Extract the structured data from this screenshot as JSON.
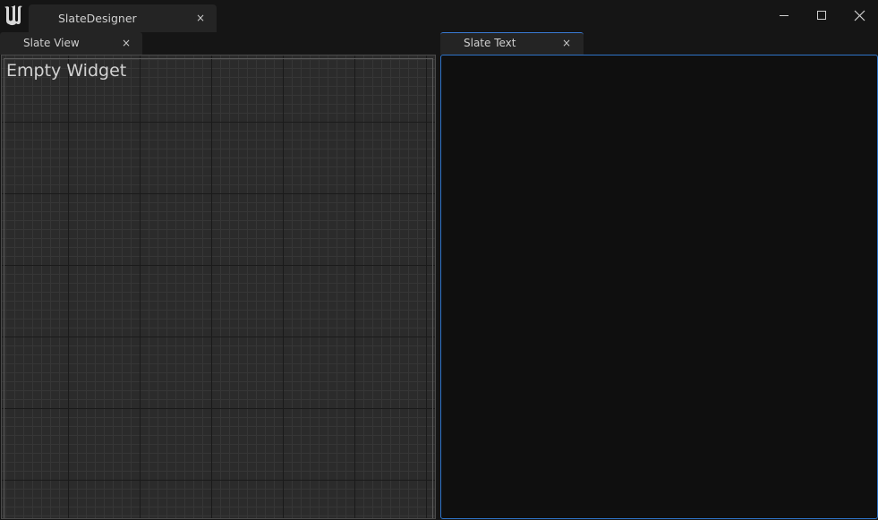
{
  "titlebar": {
    "logo_icon": "unreal-engine-logo-icon",
    "document_tab": {
      "label": "SlateDesigner",
      "close_glyph": "×"
    },
    "window_controls": {
      "minimize_icon": "minimize-icon",
      "maximize_icon": "maximize-icon",
      "close_icon": "close-icon"
    }
  },
  "left_panel": {
    "tab": {
      "label": "Slate View",
      "close_glyph": "×"
    },
    "canvas": {
      "widget_label": "Empty Widget",
      "grid_color": "#363636",
      "grid_major_color": "#1a1a1a",
      "background_color": "#2b2b2b"
    }
  },
  "right_panel": {
    "tab": {
      "label": "Slate Text",
      "close_glyph": "×"
    },
    "editor": {
      "value": "",
      "focus_color": "#2f74c9"
    }
  }
}
